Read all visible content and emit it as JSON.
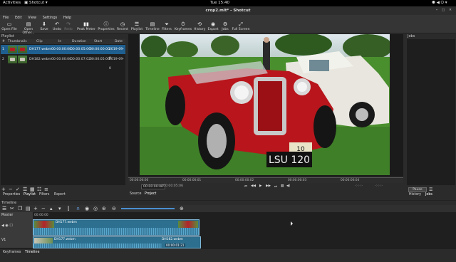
{
  "topbar": {
    "activities": "Activities",
    "app": "Shotcut",
    "clock": "Tue 15:40",
    "status_icons": "network-icon sound-icon power-icon"
  },
  "window": {
    "title": "crop2.mlt* - Shotcut"
  },
  "menu": [
    "File",
    "Edit",
    "View",
    "Settings",
    "Help"
  ],
  "toolbar": [
    {
      "label": "Open File",
      "icon": "folder-icon"
    },
    {
      "label": "Open Other...",
      "icon": "open-other-icon"
    },
    {
      "label": "Save",
      "icon": "save-icon"
    },
    {
      "label": "Undo",
      "icon": "undo-icon"
    },
    {
      "label": "Redo",
      "icon": "redo-icon"
    },
    {
      "label": "Peak Meter",
      "icon": "peak-meter-icon"
    },
    {
      "label": "Properties",
      "icon": "properties-icon"
    },
    {
      "label": "Recent",
      "icon": "recent-icon"
    },
    {
      "label": "Playlist",
      "icon": "playlist-icon"
    },
    {
      "label": "Timeline",
      "icon": "timeline-icon"
    },
    {
      "label": "Filters",
      "icon": "filters-icon"
    },
    {
      "label": "Keyframes",
      "icon": "keyframes-icon"
    },
    {
      "label": "History",
      "icon": "history-icon"
    },
    {
      "label": "Export",
      "icon": "export-icon"
    },
    {
      "label": "Jobs",
      "icon": "jobs-icon"
    },
    {
      "label": "Full Screen",
      "icon": "fullscreen-icon"
    }
  ],
  "playlist": {
    "title": "Playlist",
    "columns": [
      "#",
      "Thumbnails",
      "Clip",
      "In",
      "Duration",
      "Start",
      "Date"
    ],
    "rows": [
      {
        "num": "1",
        "clip": "DH177.webm",
        "in": "00:00:00:00",
        "duration": "00:00:05:06",
        "start": "00:00:00:00",
        "date": "2019-09-0"
      },
      {
        "num": "2",
        "clip": "DH182.webm",
        "in": "00:00:00:00",
        "duration": "00:00:07:02",
        "start": "00:00:05:06",
        "date": "2019-09-0"
      }
    ],
    "tabs": [
      "Properties",
      "Playlist",
      "Filters",
      "Export"
    ]
  },
  "viewer": {
    "ruler": [
      "00:00:00:00",
      "00:00:00:01",
      "00:00:00:02",
      "00:00:00:03",
      "00:00:00:04"
    ],
    "position": "00:00:00:00",
    "duration": "/ 00:00:05:06",
    "tabs": [
      "Source",
      "Project"
    ],
    "plate": "LSU 120",
    "plate_top": "10"
  },
  "jobs": {
    "title": "Jobs",
    "pause": "Pause",
    "tabs": [
      "History",
      "Jobs"
    ]
  },
  "timeline": {
    "title": "Timeline",
    "tracks": [
      {
        "name": "Master"
      },
      {
        "name": "V1"
      }
    ],
    "time_mark": "00:00:00",
    "clip1": "DH177.webm",
    "clip2": "DH182.webm",
    "clip2_tc": "00:00:01:21",
    "tabs": [
      "Keyframes",
      "Timeline"
    ]
  }
}
